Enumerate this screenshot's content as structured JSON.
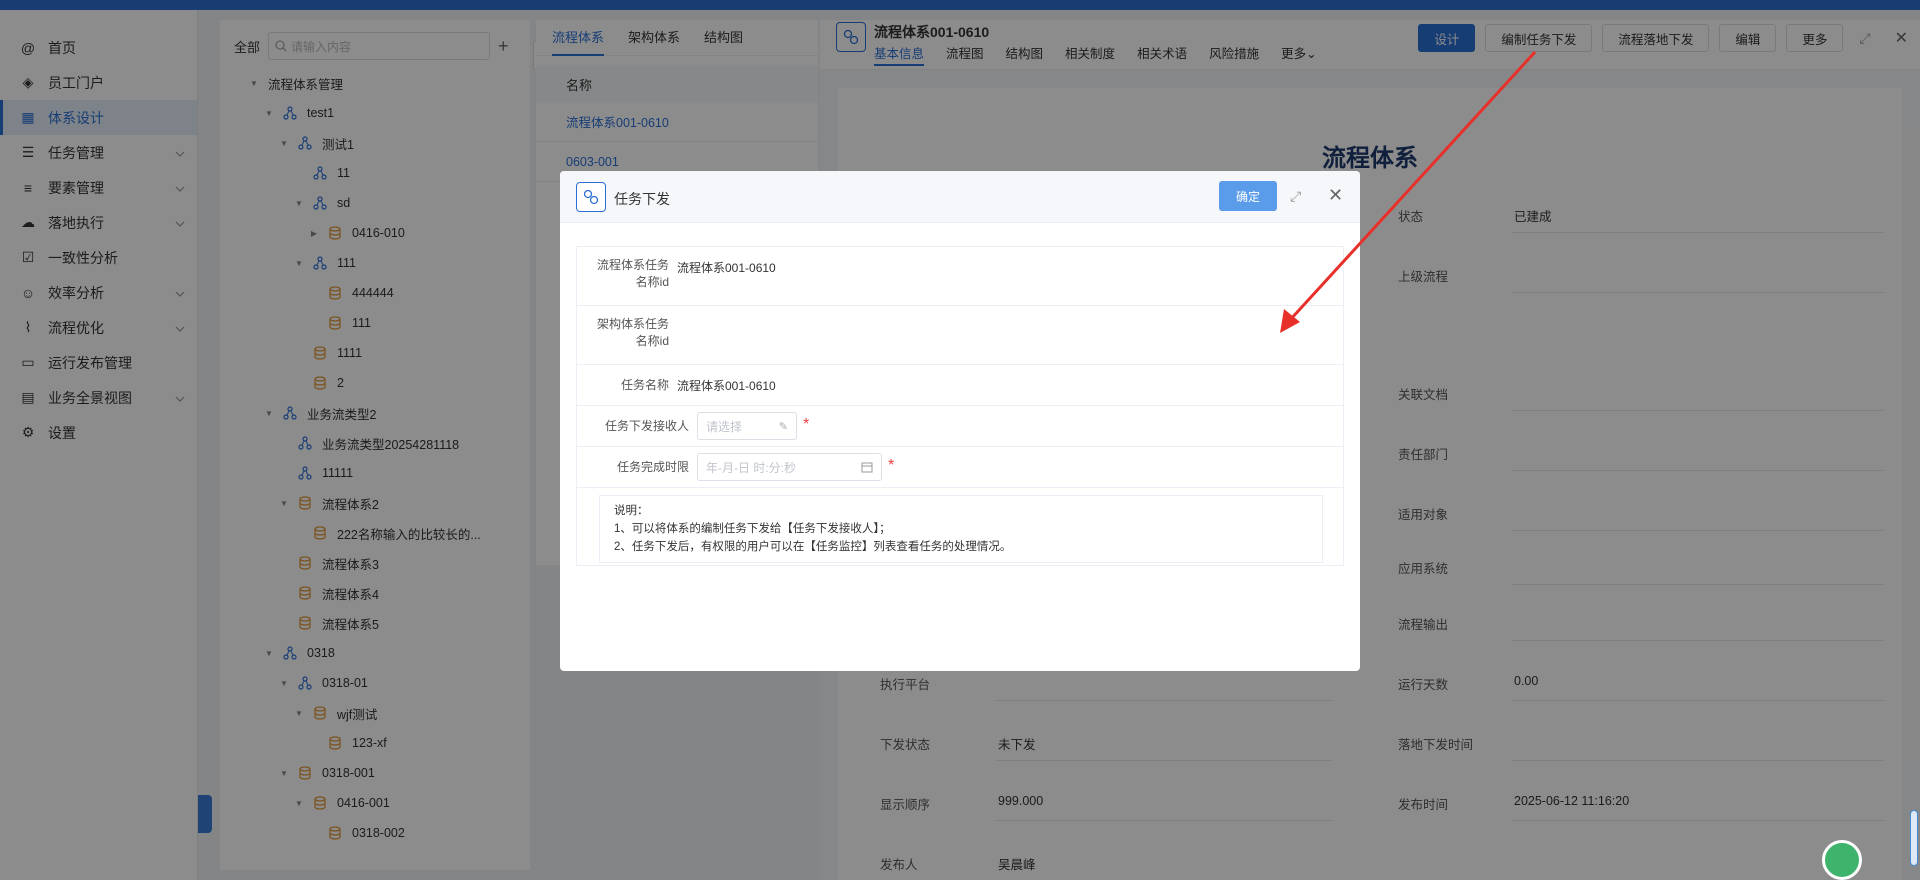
{
  "sidebar": {
    "items": [
      {
        "label": "首页",
        "icon": "at-icon"
      },
      {
        "label": "员工门户",
        "icon": "layers-icon"
      },
      {
        "label": "体系设计",
        "icon": "grid-icon",
        "active": true
      },
      {
        "label": "任务管理",
        "icon": "list-icon",
        "expandable": true
      },
      {
        "label": "要素管理",
        "icon": "bar-chart-icon",
        "expandable": true
      },
      {
        "label": "落地执行",
        "icon": "cloud-icon",
        "expandable": true
      },
      {
        "label": "一致性分析",
        "icon": "checkbox-icon"
      },
      {
        "label": "效率分析",
        "icon": "users-icon",
        "expandable": true
      },
      {
        "label": "流程优化",
        "icon": "chart-icon",
        "expandable": true
      },
      {
        "label": "运行发布管理",
        "icon": "monitor-icon"
      },
      {
        "label": "业务全景视图",
        "icon": "book-icon",
        "expandable": true
      },
      {
        "label": "设置",
        "icon": "gear-icon"
      }
    ]
  },
  "tree": {
    "all_label": "全部",
    "search_placeholder": "请输入内容",
    "nodes": [
      {
        "label": "流程体系管理",
        "depth": 0,
        "caret": "open",
        "icon": "none"
      },
      {
        "label": "test1",
        "depth": 1,
        "caret": "open",
        "icon": "hier"
      },
      {
        "label": "测试1",
        "depth": 2,
        "caret": "open",
        "icon": "hier"
      },
      {
        "label": "11",
        "depth": 3,
        "caret": "",
        "icon": "hier"
      },
      {
        "label": "sd",
        "depth": 3,
        "caret": "open",
        "icon": "hier"
      },
      {
        "label": "0416-010",
        "depth": 4,
        "caret": "closed",
        "icon": "db"
      },
      {
        "label": "111",
        "depth": 3,
        "caret": "open",
        "icon": "hier"
      },
      {
        "label": "444444",
        "depth": 4,
        "caret": "",
        "icon": "db"
      },
      {
        "label": "111",
        "depth": 4,
        "caret": "",
        "icon": "db"
      },
      {
        "label": "1111",
        "depth": 3,
        "caret": "",
        "icon": "db"
      },
      {
        "label": "2",
        "depth": 3,
        "caret": "",
        "icon": "db"
      },
      {
        "label": "业务流类型2",
        "depth": 1,
        "caret": "open",
        "icon": "hier"
      },
      {
        "label": "业务流类型20254281118",
        "depth": 2,
        "caret": "",
        "icon": "hier"
      },
      {
        "label": "11111",
        "depth": 2,
        "caret": "",
        "icon": "hier"
      },
      {
        "label": "流程体系2",
        "depth": 2,
        "caret": "open",
        "icon": "db"
      },
      {
        "label": "222名称输入的比较长的...",
        "depth": 3,
        "caret": "",
        "icon": "db"
      },
      {
        "label": "流程体系3",
        "depth": 2,
        "caret": "",
        "icon": "db"
      },
      {
        "label": "流程体系4",
        "depth": 2,
        "caret": "",
        "icon": "db"
      },
      {
        "label": "流程体系5",
        "depth": 2,
        "caret": "",
        "icon": "db"
      },
      {
        "label": "0318",
        "depth": 1,
        "caret": "open",
        "icon": "hier"
      },
      {
        "label": "0318-01",
        "depth": 2,
        "caret": "open",
        "icon": "hier"
      },
      {
        "label": "wjf测试",
        "depth": 3,
        "caret": "open",
        "icon": "db"
      },
      {
        "label": "123-xf",
        "depth": 4,
        "caret": "",
        "icon": "db"
      },
      {
        "label": "0318-001",
        "depth": 2,
        "caret": "open",
        "icon": "db"
      },
      {
        "label": "0416-001",
        "depth": 3,
        "caret": "open",
        "icon": "db"
      },
      {
        "label": "0318-002",
        "depth": 4,
        "caret": "",
        "icon": "db"
      }
    ]
  },
  "list": {
    "tabs": [
      "流程体系",
      "架构体系",
      "结构图"
    ],
    "header": "名称",
    "rows": [
      "流程体系001-0610",
      "0603-001"
    ]
  },
  "detail": {
    "title": "流程体系001-0610",
    "tabs": [
      "基本信息",
      "流程图",
      "结构图",
      "相关制度",
      "相关术语",
      "风险措施",
      "更多"
    ],
    "buttons": [
      "设计",
      "编制任务下发",
      "流程落地下发",
      "编辑",
      "更多"
    ],
    "doc_title": "流程体系",
    "right_fields": [
      {
        "label": "状态",
        "value": "已建成"
      },
      {
        "label": "上级流程",
        "value": ""
      },
      {
        "label": "关联文档",
        "value": ""
      },
      {
        "label": "责任部门",
        "value": ""
      },
      {
        "label": "适用对象",
        "value": ""
      },
      {
        "label": "应用系统",
        "value": ""
      },
      {
        "label": "流程输出",
        "value": ""
      },
      {
        "label": "运行天数",
        "value": "0.00"
      },
      {
        "label": "落地下发时间",
        "value": ""
      },
      {
        "label": "发布时间",
        "value": "2025-06-12 11:16:20"
      }
    ],
    "left_fields": [
      {
        "label": "执行平台",
        "value": ""
      },
      {
        "label": "下发状态",
        "value": "未下发"
      },
      {
        "label": "显示顺序",
        "value": "999.000"
      },
      {
        "label": "发布人",
        "value": "吴晨峰"
      }
    ]
  },
  "modal": {
    "title": "任务下发",
    "confirm": "确定",
    "rows": {
      "process_task_label_1": "流程体系任务",
      "process_task_label_2": "名称id",
      "process_task_value": "流程体系001-0610",
      "arch_task_label_1": "架构体系任务",
      "arch_task_label_2": "名称id",
      "task_name_label": "任务名称",
      "task_name_value": "流程体系001-0610",
      "receiver_label": "任务下发接收人",
      "receiver_placeholder": "请选择",
      "deadline_label": "任务完成时限",
      "deadline_placeholder": "年-月-日 时:分:秒"
    },
    "note": {
      "title": "说明：",
      "line1": "1、可以将体系的编制任务下发给【任务下发接收人】；",
      "line2": "2、任务下发后，有权限的用户可以在【任务监控】列表查看任务的处理情况。"
    }
  },
  "colors": {
    "accent": "#2b6fd6",
    "annotation_arrow": "#e8302a",
    "required": "#e83d3d"
  }
}
